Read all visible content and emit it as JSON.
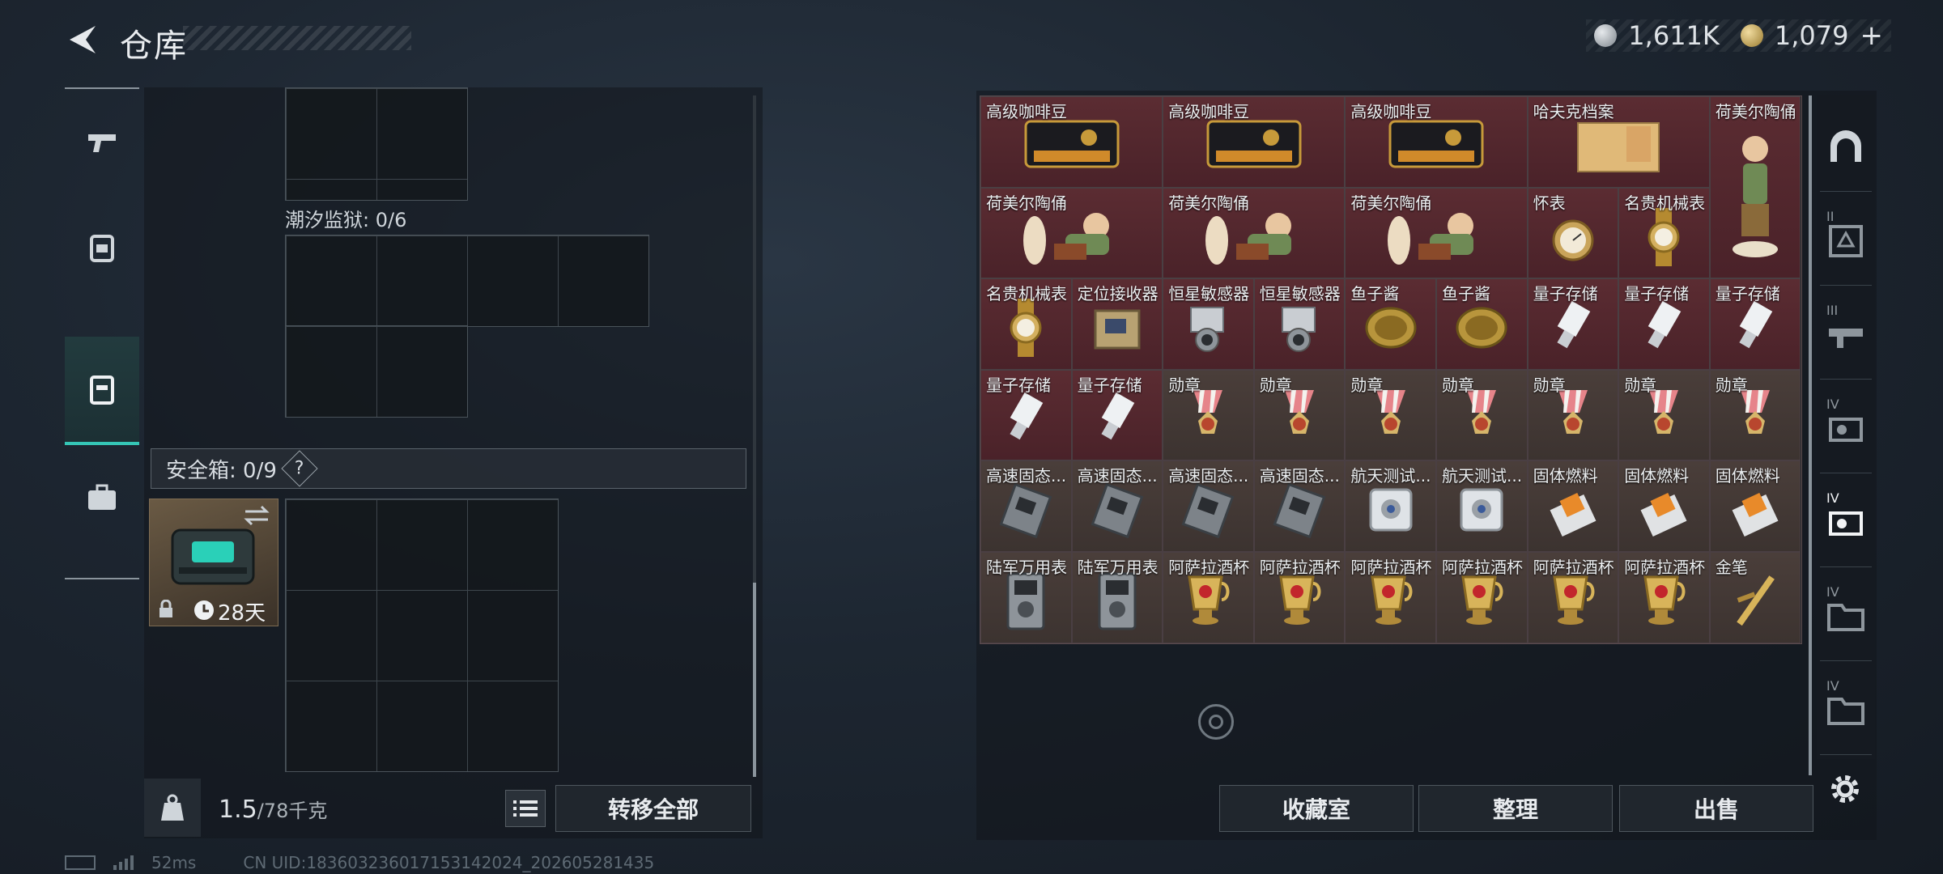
{
  "header": {
    "title": "仓库",
    "currency": [
      {
        "icon": "silver-coin-icon",
        "value": "1,611K"
      },
      {
        "icon": "gold-coin-icon",
        "value": "1,079"
      }
    ],
    "add_label": "+"
  },
  "left_nav": [
    {
      "icon": "gun-icon",
      "active": false
    },
    {
      "icon": "backpack-icon",
      "active": false
    },
    {
      "icon": "case-icon",
      "active": true
    },
    {
      "icon": "briefcase-icon",
      "active": false
    }
  ],
  "storage": {
    "tide_prison_label": "潮汐监狱: 0/6",
    "safe_box_label": "安全箱: 0/9",
    "help_label": "?",
    "safe_box_days": "28天"
  },
  "bottom_left": {
    "weight_value": "1.5",
    "weight_max": "/78千克",
    "transfer_all": "转移全部"
  },
  "items": [
    {
      "name": "高级咖啡豆",
      "color": "red",
      "art": "coffee"
    },
    {
      "name": "高级咖啡豆",
      "color": "red",
      "art": "coffee"
    },
    {
      "name": "高级咖啡豆",
      "color": "red",
      "art": "coffee"
    },
    {
      "name": "哈夫克档案",
      "color": "red",
      "art": "file"
    },
    {
      "name": "荷美尔陶俑",
      "color": "red",
      "art": "figurine-tall"
    },
    {
      "name": "荷美尔陶俑",
      "color": "red",
      "art": "figurine"
    },
    {
      "name": "荷美尔陶俑",
      "color": "red",
      "art": "figurine"
    },
    {
      "name": "荷美尔陶俑",
      "color": "red",
      "art": "figurine"
    },
    {
      "name": "怀表",
      "color": "red",
      "art": "pocketwatch"
    },
    {
      "name": "名贵机械表",
      "color": "red",
      "art": "watch"
    },
    {
      "name": "名贵机械表",
      "color": "red",
      "art": "watch"
    },
    {
      "name": "定位接收器",
      "color": "red",
      "art": "receiver"
    },
    {
      "name": "恒星敏感器",
      "color": "red",
      "art": "sensor"
    },
    {
      "name": "恒星敏感器",
      "color": "red",
      "art": "sensor"
    },
    {
      "name": "鱼子酱",
      "color": "red",
      "art": "caviar"
    },
    {
      "name": "鱼子酱",
      "color": "red",
      "art": "caviar"
    },
    {
      "name": "量子存储",
      "color": "red",
      "art": "usb"
    },
    {
      "name": "量子存储",
      "color": "red",
      "art": "usb"
    },
    {
      "name": "量子存储",
      "color": "red",
      "art": "usb"
    },
    {
      "name": "量子存储",
      "color": "red",
      "art": "usb"
    },
    {
      "name": "量子存储",
      "color": "red",
      "art": "usb"
    },
    {
      "name": "勋章",
      "color": "brown",
      "art": "medal"
    },
    {
      "name": "勋章",
      "color": "brown",
      "art": "medal"
    },
    {
      "name": "勋章",
      "color": "brown",
      "art": "medal"
    },
    {
      "name": "勋章",
      "color": "brown",
      "art": "medal"
    },
    {
      "name": "勋章",
      "color": "brown",
      "art": "medal"
    },
    {
      "name": "勋章",
      "color": "brown",
      "art": "medal"
    },
    {
      "name": "勋章",
      "color": "brown",
      "art": "medal"
    },
    {
      "name": "高速固态...",
      "color": "brown",
      "art": "ssd"
    },
    {
      "name": "高速固态...",
      "color": "brown",
      "art": "ssd"
    },
    {
      "name": "高速固态...",
      "color": "brown",
      "art": "ssd"
    },
    {
      "name": "高速固态...",
      "color": "brown",
      "art": "ssd"
    },
    {
      "name": "航天测试...",
      "color": "brown",
      "art": "disk"
    },
    {
      "name": "航天测试...",
      "color": "brown",
      "art": "disk"
    },
    {
      "name": "固体燃料",
      "color": "brown",
      "art": "fuel"
    },
    {
      "name": "固体燃料",
      "color": "brown",
      "art": "fuel"
    },
    {
      "name": "固体燃料",
      "color": "brown",
      "art": "fuel"
    },
    {
      "name": "陆军万用表",
      "color": "brown",
      "art": "multimeter"
    },
    {
      "name": "陆军万用表",
      "color": "brown",
      "art": "multimeter"
    },
    {
      "name": "阿萨拉酒杯",
      "color": "brown",
      "art": "cup"
    },
    {
      "name": "阿萨拉酒杯",
      "color": "brown",
      "art": "cup"
    },
    {
      "name": "阿萨拉酒杯",
      "color": "brown",
      "art": "cup"
    },
    {
      "name": "阿萨拉酒杯",
      "color": "brown",
      "art": "cup"
    },
    {
      "name": "阿萨拉酒杯",
      "color": "brown",
      "art": "cup"
    },
    {
      "name": "阿萨拉酒杯",
      "color": "brown",
      "art": "cup"
    },
    {
      "name": "金笔",
      "color": "brown",
      "art": "pen"
    }
  ],
  "bottom_right": {
    "collection": "收藏室",
    "sort": "整理",
    "sell": "出售"
  },
  "right_nav": [
    {
      "label": "",
      "icon": "dome-icon",
      "active": false
    },
    {
      "label": "II",
      "icon": "shelf-icon",
      "active": false
    },
    {
      "label": "III",
      "icon": "weapon-rack-icon",
      "active": false
    },
    {
      "label": "IV",
      "icon": "device-icon",
      "active": false
    },
    {
      "label": "IV",
      "icon": "device-icon",
      "active": true
    },
    {
      "label": "IV",
      "icon": "folder-icon",
      "active": false
    },
    {
      "label": "IV",
      "icon": "folder-icon",
      "active": false
    }
  ],
  "status": {
    "ping": "52ms",
    "uid": "CN UID:18360323601715314​2024_202605281435"
  },
  "colors": {
    "accent": "#35c6b6",
    "red_cell": "#5b2c32",
    "brown_cell": "#4a3e3a"
  }
}
